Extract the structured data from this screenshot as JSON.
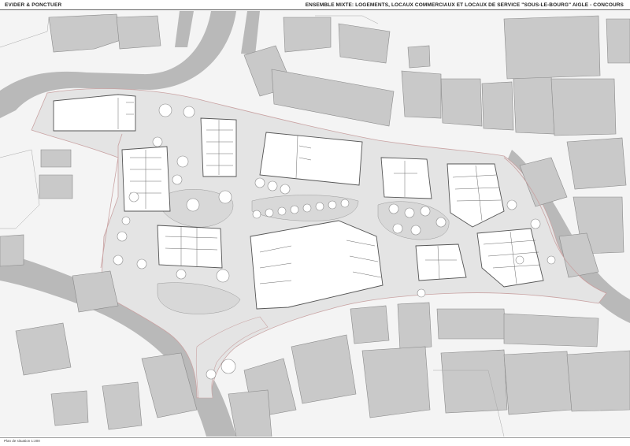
{
  "header": {
    "left_title": "EVIDER & PONCTUER",
    "right_title": "ENSEMBLE MIXTE: LOGEMENTS, LOCAUX COMMERCIAUX ET LOCAUX DE SERVICE \"SOUS-LE-BOURG\" AIGLE - CONCOURS"
  },
  "footer": {
    "caption": "Plan de situation 1:200"
  },
  "colors": {
    "building_grey": "#c9c9c9",
    "street_grey": "#b9b9b9",
    "plaza_grey": "#e2e2e2",
    "green_grey": "#d6d6d6",
    "interior_white": "#ffffff",
    "outline": "#7a7a7a",
    "perimeter": "#c9a3a3"
  }
}
